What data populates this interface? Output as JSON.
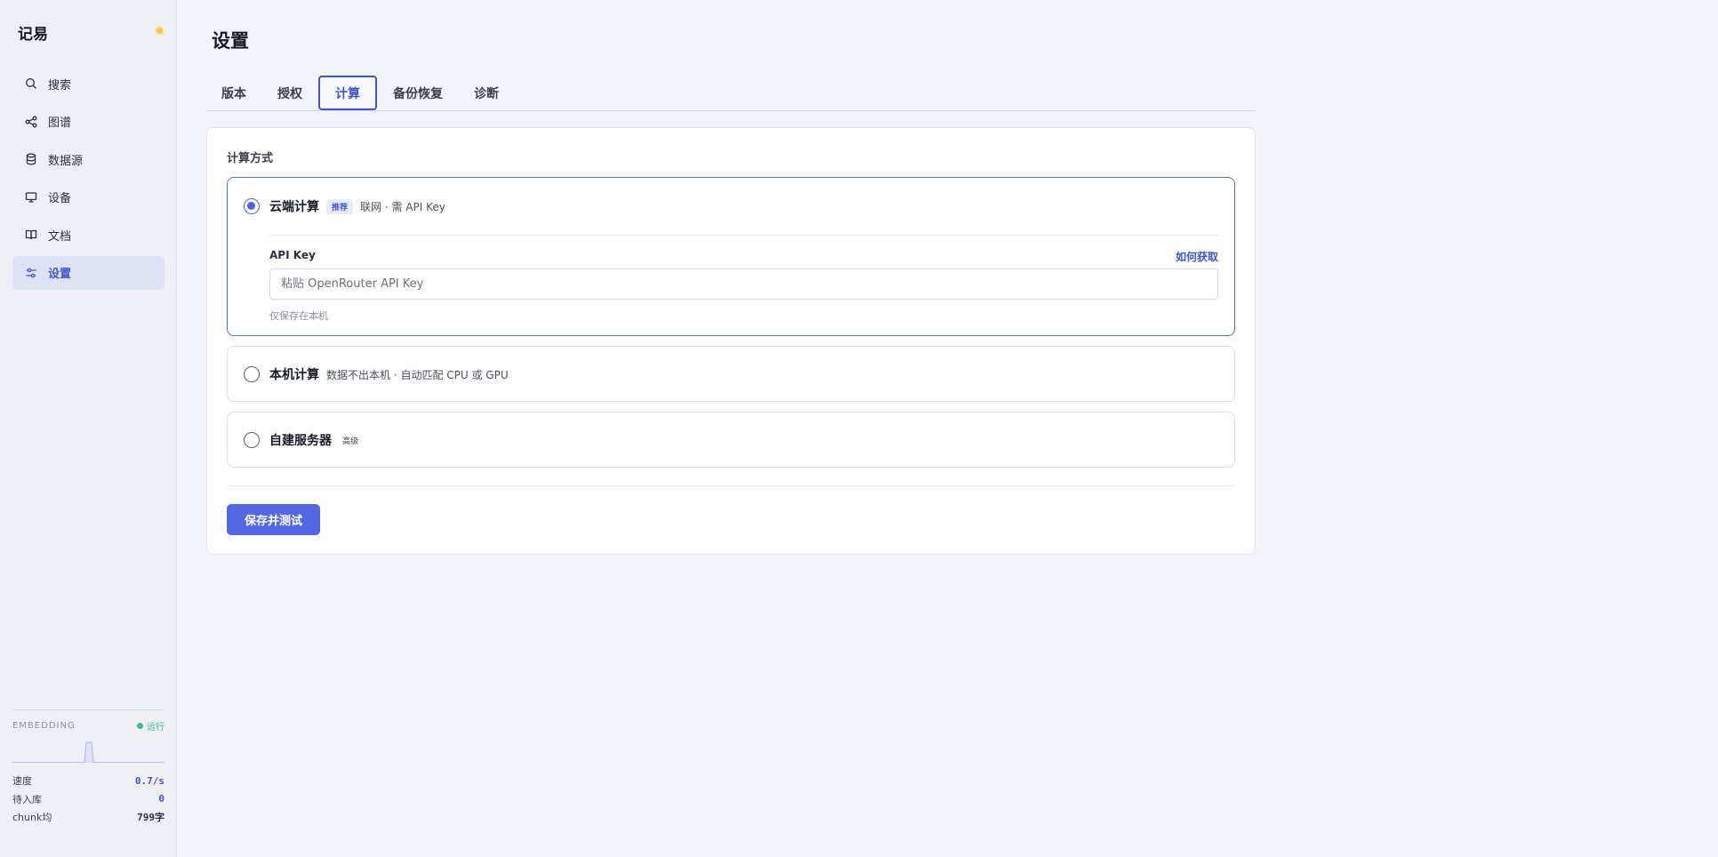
{
  "app": {
    "name": "记易"
  },
  "sidebar": {
    "items": [
      {
        "label": "搜索",
        "icon": "search-icon"
      },
      {
        "label": "图谱",
        "icon": "graph-icon"
      },
      {
        "label": "数据源",
        "icon": "database-icon"
      },
      {
        "label": "设备",
        "icon": "monitor-icon"
      },
      {
        "label": "文档",
        "icon": "book-icon"
      },
      {
        "label": "设置",
        "icon": "sliders-icon",
        "active": true
      }
    ],
    "embedding": {
      "title": "EMBEDDING",
      "status": "运行",
      "stats": [
        {
          "label": "速度",
          "value": "0.7/s"
        },
        {
          "label": "待入库",
          "value": "0"
        },
        {
          "label": "chunk均",
          "value": "799字"
        }
      ]
    }
  },
  "page": {
    "title": "设置"
  },
  "tabs": [
    {
      "label": "版本"
    },
    {
      "label": "授权"
    },
    {
      "label": "计算",
      "active": true
    },
    {
      "label": "备份恢复"
    },
    {
      "label": "诊断"
    }
  ],
  "compute": {
    "section_label": "计算方式",
    "options": [
      {
        "name": "云端计算",
        "badge": "推荐",
        "desc": "联网 · 需 API Key",
        "selected": true
      },
      {
        "name": "本机计算",
        "badge": "",
        "desc": "数据不出本机 · 自动匹配 CPU 或 GPU",
        "selected": false
      },
      {
        "name": "自建服务器",
        "badge": "高级",
        "desc": "",
        "selected": false
      }
    ],
    "api_key": {
      "label": "API Key",
      "link": "如何获取",
      "value": "",
      "placeholder": "粘贴 OpenRouter API Key",
      "hint": "仅保存在本机"
    },
    "save_label": "保存并测试"
  },
  "colors": {
    "accent": "#4f63e0",
    "status_ok": "#34c08a"
  }
}
